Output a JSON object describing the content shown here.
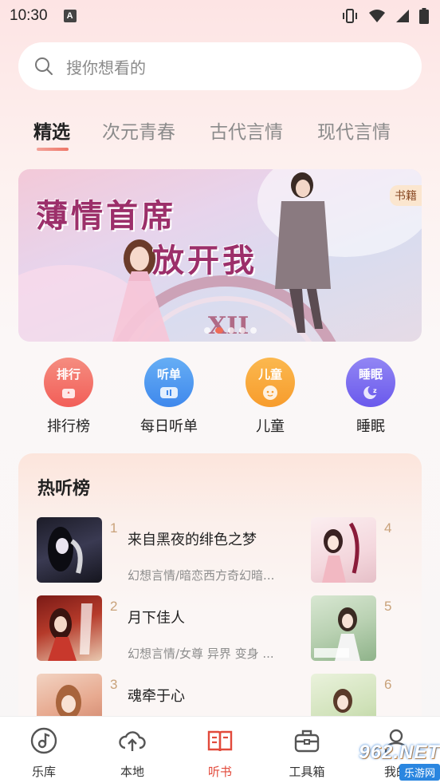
{
  "status_bar": {
    "time": "10:30",
    "notification_icon": "A"
  },
  "search": {
    "placeholder": "搜你想看的"
  },
  "tabs": [
    {
      "label": "精选",
      "active": true
    },
    {
      "label": "次元青春",
      "active": false
    },
    {
      "label": "古代言情",
      "active": false
    },
    {
      "label": "现代言情",
      "active": false
    }
  ],
  "banner": {
    "title_line1": "薄情首席",
    "title_line2": "放开我",
    "badge": "书籍",
    "slide_count": 5,
    "active_slide": 2
  },
  "categories": [
    {
      "icon_text": "排行",
      "label": "排行榜",
      "color": "#f4665e",
      "icon": "ranking-icon"
    },
    {
      "icon_text": "听单",
      "label": "每日听单",
      "color": "#4d97f0",
      "icon": "playlist-icon"
    },
    {
      "icon_text": "儿童",
      "label": "儿童",
      "color": "#f9a93c",
      "icon": "child-icon"
    },
    {
      "icon_text": "睡眠",
      "label": "睡眠",
      "color": "#7b6cf0",
      "icon": "sleep-icon"
    }
  ],
  "hot_list": {
    "title": "热听榜",
    "books": [
      {
        "rank": "1",
        "title": "来自黑夜的绯色之梦",
        "tags": "幻想言情/暗恋西方奇幻暗..."
      },
      {
        "rank": "2",
        "title": "月下佳人",
        "tags": "幻想言情/女尊 异界 变身 ..."
      },
      {
        "rank": "3",
        "title": "魂牵于心",
        "tags": ""
      },
      {
        "rank": "4",
        "title": "",
        "tags": ""
      },
      {
        "rank": "5",
        "title": "",
        "tags": ""
      },
      {
        "rank": "6",
        "title": "",
        "tags": ""
      }
    ]
  },
  "bottom_nav": [
    {
      "label": "乐库",
      "icon": "music-library-icon",
      "active": false
    },
    {
      "label": "本地",
      "icon": "cloud-upload-icon",
      "active": false
    },
    {
      "label": "听书",
      "icon": "book-icon",
      "active": true
    },
    {
      "label": "工具箱",
      "icon": "toolbox-icon",
      "active": false
    },
    {
      "label": "我的",
      "icon": "profile-icon",
      "active": false
    }
  ],
  "watermark": {
    "logo": "962.NET",
    "sub": "乐游网"
  },
  "colors": {
    "accent": "#e24a3b",
    "tab_indicator": "#ee7667",
    "rank_number": "#c9a27a"
  }
}
